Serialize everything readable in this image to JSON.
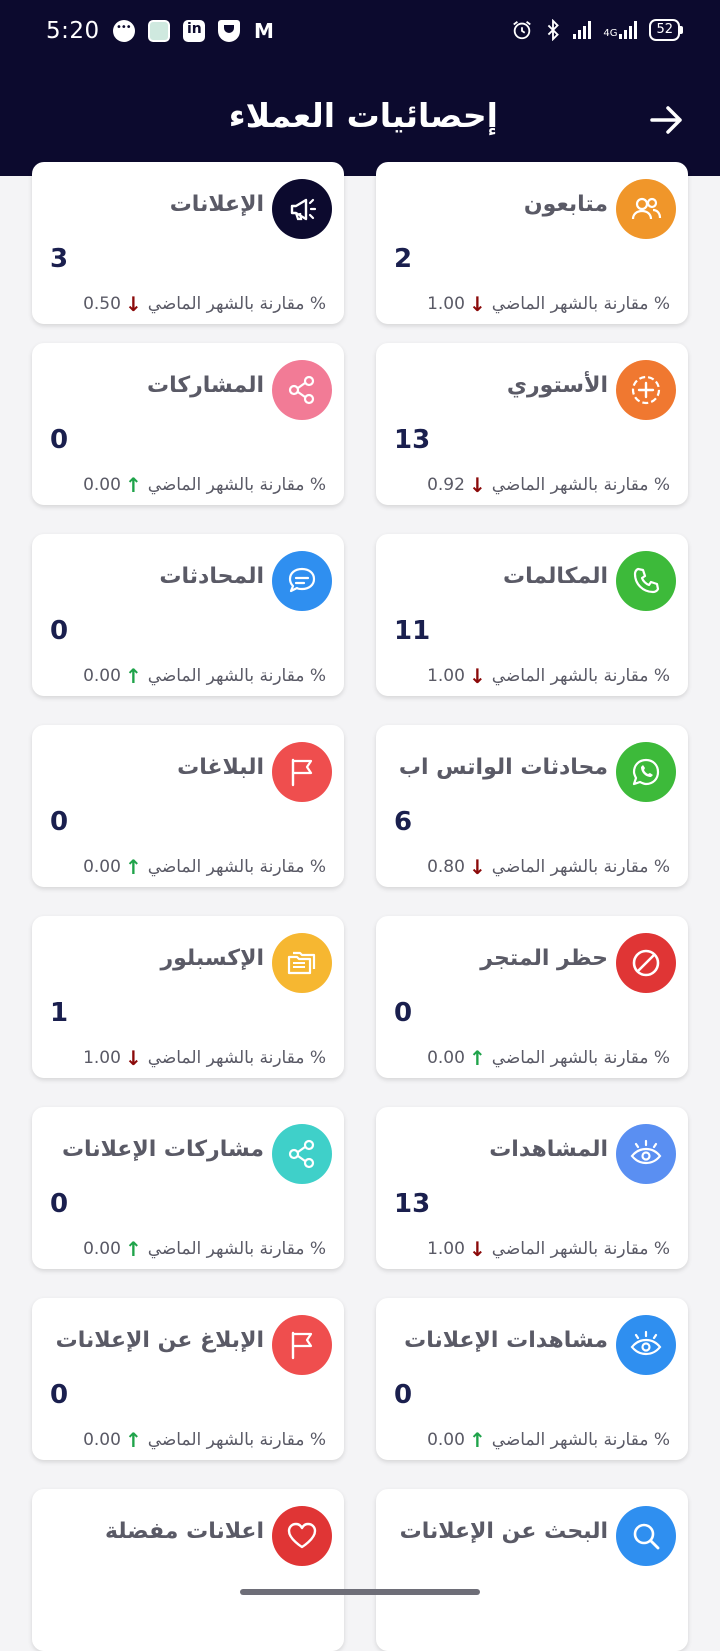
{
  "status_bar": {
    "time": "5:20",
    "battery": "52",
    "network": "4G"
  },
  "app_bar": {
    "title": "إحصائيات العملاء"
  },
  "compare_text": "% مقارنة بالشهر الماضي",
  "cards": [
    {
      "label": "الإعلانات",
      "value": "3",
      "pct": "0.50",
      "trend": "down",
      "icon": "megaphone-icon",
      "color": "#0c0a2e"
    },
    {
      "label": "متابعون",
      "value": "2",
      "pct": "1.00",
      "trend": "down",
      "icon": "users-icon",
      "color": "#f0962a"
    },
    {
      "label": "المشاركات",
      "value": "0",
      "pct": "0.00",
      "trend": "up",
      "icon": "share-icon",
      "color": "#f27b96"
    },
    {
      "label": "الأستوري",
      "value": "13",
      "pct": "0.92",
      "trend": "down",
      "icon": "story-plus-icon",
      "color": "#f07830"
    },
    {
      "label": "المحادثات",
      "value": "0",
      "pct": "0.00",
      "trend": "up",
      "icon": "chat-icon",
      "color": "#2f8ff0"
    },
    {
      "label": "المكالمات",
      "value": "11",
      "pct": "1.00",
      "trend": "down",
      "icon": "phone-icon",
      "color": "#3dba3a"
    },
    {
      "label": "البلاغات",
      "value": "0",
      "pct": "0.00",
      "trend": "up",
      "icon": "flag-icon",
      "color": "#ef4e4e"
    },
    {
      "label": "محادثات الواتس اب",
      "value": "6",
      "pct": "0.80",
      "trend": "down",
      "icon": "whatsapp-icon",
      "color": "#3dba3a"
    },
    {
      "label": "الإكسبلور",
      "value": "1",
      "pct": "1.00",
      "trend": "down",
      "icon": "folders-icon",
      "color": "#f6b731"
    },
    {
      "label": "حظر المتجر",
      "value": "0",
      "pct": "0.00",
      "trend": "up",
      "icon": "block-icon",
      "color": "#e03535"
    },
    {
      "label": "مشاركات الإعلانات",
      "value": "0",
      "pct": "0.00",
      "trend": "up",
      "icon": "share-icon",
      "color": "#3fd0c9"
    },
    {
      "label": "المشاهدات",
      "value": "13",
      "pct": "1.00",
      "trend": "down",
      "icon": "eye-icon",
      "color": "#5a8ff2"
    },
    {
      "label": "الإبلاغ عن الإعلانات",
      "value": "0",
      "pct": "0.00",
      "trend": "up",
      "icon": "flag-icon",
      "color": "#ef4e4e"
    },
    {
      "label": "مشاهدات الإعلانات",
      "value": "0",
      "pct": "0.00",
      "trend": "up",
      "icon": "eye-icon",
      "color": "#2f8ff0"
    },
    {
      "label": "اعلانات مفضلة",
      "value": "",
      "pct": "",
      "trend": "",
      "icon": "heart-icon",
      "color": "#e03535"
    },
    {
      "label": "البحث عن الإعلانات",
      "value": "",
      "pct": "",
      "trend": "",
      "icon": "search-icon",
      "color": "#2f8ff0"
    }
  ]
}
